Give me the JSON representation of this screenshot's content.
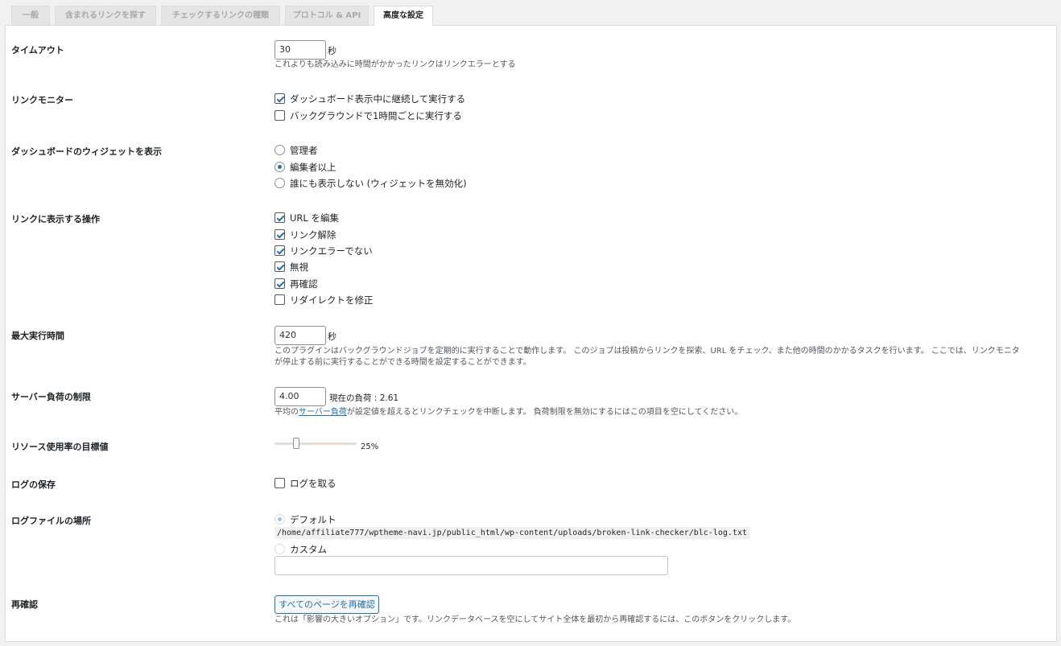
{
  "tabs": [
    {
      "label": "一般"
    },
    {
      "label": "含まれるリンクを探す"
    },
    {
      "label": "チェックするリンクの種類"
    },
    {
      "label": "プロトコル & API"
    },
    {
      "label": "高度な設定"
    }
  ],
  "timeout": {
    "label": "タイムアウト",
    "value": "30",
    "unit": "秒",
    "description": "これよりも読み込みに時間がかかったリンクはリンクエラーとする"
  },
  "link_monitor": {
    "label": "リンクモニター",
    "options": [
      {
        "label": "ダッシュボード表示中に継続して実行する",
        "checked": true
      },
      {
        "label": "バックグラウンドで1時間ごとに実行する",
        "checked": false
      }
    ]
  },
  "dashboard_widget": {
    "label": "ダッシュボードのウィジェットを表示",
    "options": [
      {
        "label": "管理者",
        "selected": false
      },
      {
        "label": "編集者以上",
        "selected": true
      },
      {
        "label": "誰にも表示しない (ウィジェットを無効化)",
        "selected": false
      }
    ]
  },
  "link_actions": {
    "label": "リンクに表示する操作",
    "options": [
      {
        "label": "URL を編集",
        "checked": true
      },
      {
        "label": "リンク解除",
        "checked": true
      },
      {
        "label": "リンクエラーでない",
        "checked": true
      },
      {
        "label": "無視",
        "checked": true
      },
      {
        "label": "再確認",
        "checked": true
      },
      {
        "label": "リダイレクトを修正",
        "checked": false
      }
    ]
  },
  "max_execution": {
    "label": "最大実行時間",
    "value": "420",
    "unit": "秒",
    "description_line1": "このプラグインはバックグラウンドジョブを定期的に実行することで動作します。 このジョブは投稿からリンクを探索、URL をチェック、また他の時間のかかるタスクを行います。 ここでは、リンクモニタ",
    "description_line2": "が停止する前に実行することができる時間を設定することができます。"
  },
  "server_load": {
    "label": "サーバー負荷の制限",
    "value": "4.00",
    "current_label": "現在の負荷 : 2.61",
    "desc_before": "平均の",
    "desc_link": "サーバー負荷",
    "desc_after": "が設定値を超えるとリンクチェックを中断します。 負荷制限を無効にするにはこの項目を空にしてください。"
  },
  "resource_usage": {
    "label": "リソース使用率の目標値",
    "value_text": "25%",
    "value": 0.25
  },
  "logging": {
    "label": "ログの保存",
    "option": {
      "label": "ログを取る",
      "checked": false
    }
  },
  "log_location": {
    "label": "ログファイルの場所",
    "default_label": "デフォルト",
    "default_path": "/home/affiliate777/wptheme-navi.jp/public_html/wp-content/uploads/broken-link-checker/blc-log.txt",
    "custom_label": "カスタム",
    "custom_value": ""
  },
  "recheck": {
    "label": "再確認",
    "button_label": "すべてのページを再確認",
    "description": "これは「影響の大きいオプション」です。リンクデータベースを空にしてサイト全体を最初から再確認するには、このボタンをクリックします。"
  }
}
